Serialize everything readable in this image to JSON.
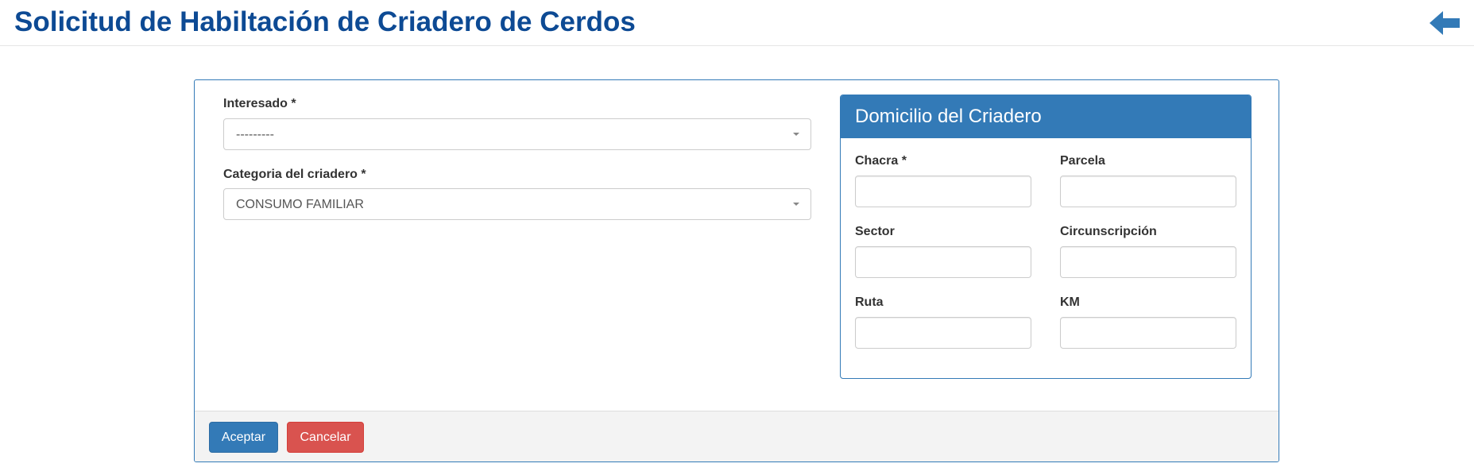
{
  "header": {
    "title": "Solicitud de Habiltación de Criadero de Cerdos",
    "back_icon": "arrow-left-icon"
  },
  "colors": {
    "title": "#0d4a94",
    "primary": "#337ab7",
    "danger": "#d9534f"
  },
  "form": {
    "interesado": {
      "label": "Interesado *",
      "value": "---------"
    },
    "categoria": {
      "label": "Categoria del criadero *",
      "value": "CONSUMO FAMILIAR"
    },
    "domicilio": {
      "title": "Domicilio del Criadero",
      "fields": {
        "chacra": {
          "label": "Chacra *",
          "value": ""
        },
        "parcela": {
          "label": "Parcela",
          "value": ""
        },
        "sector": {
          "label": "Sector",
          "value": ""
        },
        "circunscripcion": {
          "label": "Circunscripción",
          "value": ""
        },
        "ruta": {
          "label": "Ruta",
          "value": ""
        },
        "km": {
          "label": "KM",
          "value": ""
        }
      }
    }
  },
  "footer": {
    "accept_label": "Aceptar",
    "cancel_label": "Cancelar"
  }
}
